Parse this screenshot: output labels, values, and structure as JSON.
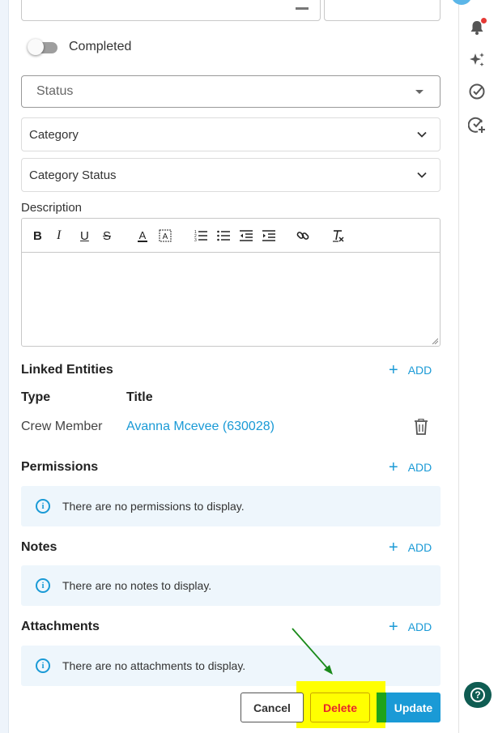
{
  "form": {
    "completed_label": "Completed",
    "status_placeholder": "Status",
    "category_placeholder": "Category",
    "category_status_placeholder": "Category Status",
    "description_label": "Description"
  },
  "editor_toolbar": {
    "bold": "B",
    "italic": "I",
    "underline": "U",
    "strike": "S",
    "font_color": "A"
  },
  "linked_entities": {
    "title": "Linked Entities",
    "add_label": "ADD",
    "columns": [
      "Type",
      "Title"
    ],
    "rows": [
      {
        "type": "Crew Member",
        "title": "Avanna Mcevee (630028)"
      }
    ]
  },
  "permissions": {
    "title": "Permissions",
    "add_label": "ADD",
    "empty_text": "There are no permissions to display."
  },
  "notes": {
    "title": "Notes",
    "add_label": "ADD",
    "empty_text": "There are no notes to display."
  },
  "attachments": {
    "title": "Attachments",
    "add_label": "ADD",
    "empty_text": "There are no attachments to display."
  },
  "footer": {
    "cancel_label": "Cancel",
    "delete_label": "Delete",
    "update_label": "Update"
  },
  "icons": {
    "info_glyph": "i",
    "help_glyph": "?"
  },
  "colors": {
    "accent": "#1a9ad6",
    "delete_text": "#e8262b",
    "highlight": "#ffff00",
    "help_button": "#0f5c52",
    "annotation_arrow": "#1a8a1a"
  }
}
